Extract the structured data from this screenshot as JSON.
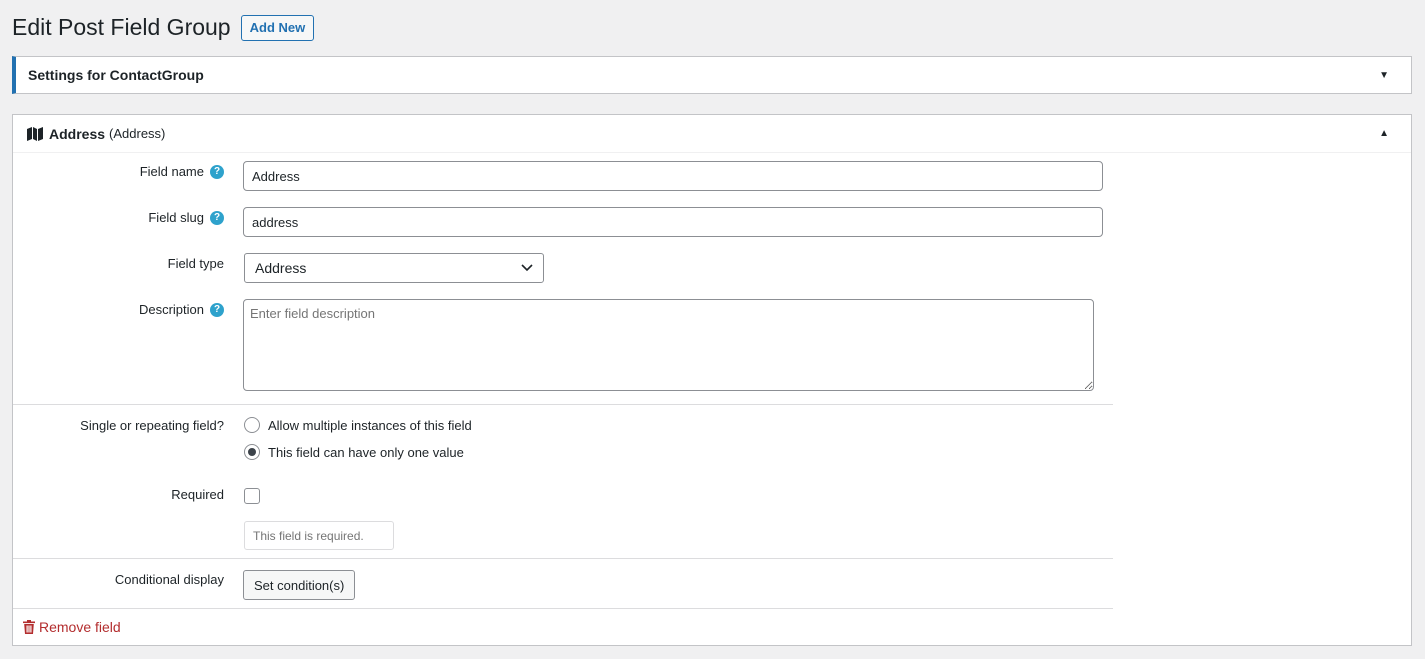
{
  "header": {
    "title": "Edit Post Field Group",
    "add_new_label": "Add New"
  },
  "settings_box": {
    "title": "Settings for ContactGroup",
    "toggle_icon": "caret-down-icon"
  },
  "field": {
    "title": "Address",
    "subtitle": "(Address)",
    "icon": "map-icon",
    "toggle_icon": "caret-up-icon",
    "field_name": {
      "label": "Field name",
      "value": "Address"
    },
    "field_slug": {
      "label": "Field slug",
      "value": "address"
    },
    "field_type": {
      "label": "Field type",
      "selected": "Address"
    },
    "description": {
      "label": "Description",
      "placeholder": "Enter field description"
    },
    "repeating": {
      "label": "Single or repeating field?",
      "options": [
        {
          "label": "Allow multiple instances of this field",
          "checked": false
        },
        {
          "label": "This field can have only one value",
          "checked": true
        }
      ]
    },
    "required": {
      "label": "Required",
      "checked": false,
      "message_placeholder": "This field is required."
    },
    "conditional": {
      "label": "Conditional display",
      "button_label": "Set condition(s)"
    },
    "remove_label": "Remove field"
  },
  "colors": {
    "accent": "#2271b1",
    "help": "#2ea2cc",
    "danger": "#b32d2e"
  }
}
